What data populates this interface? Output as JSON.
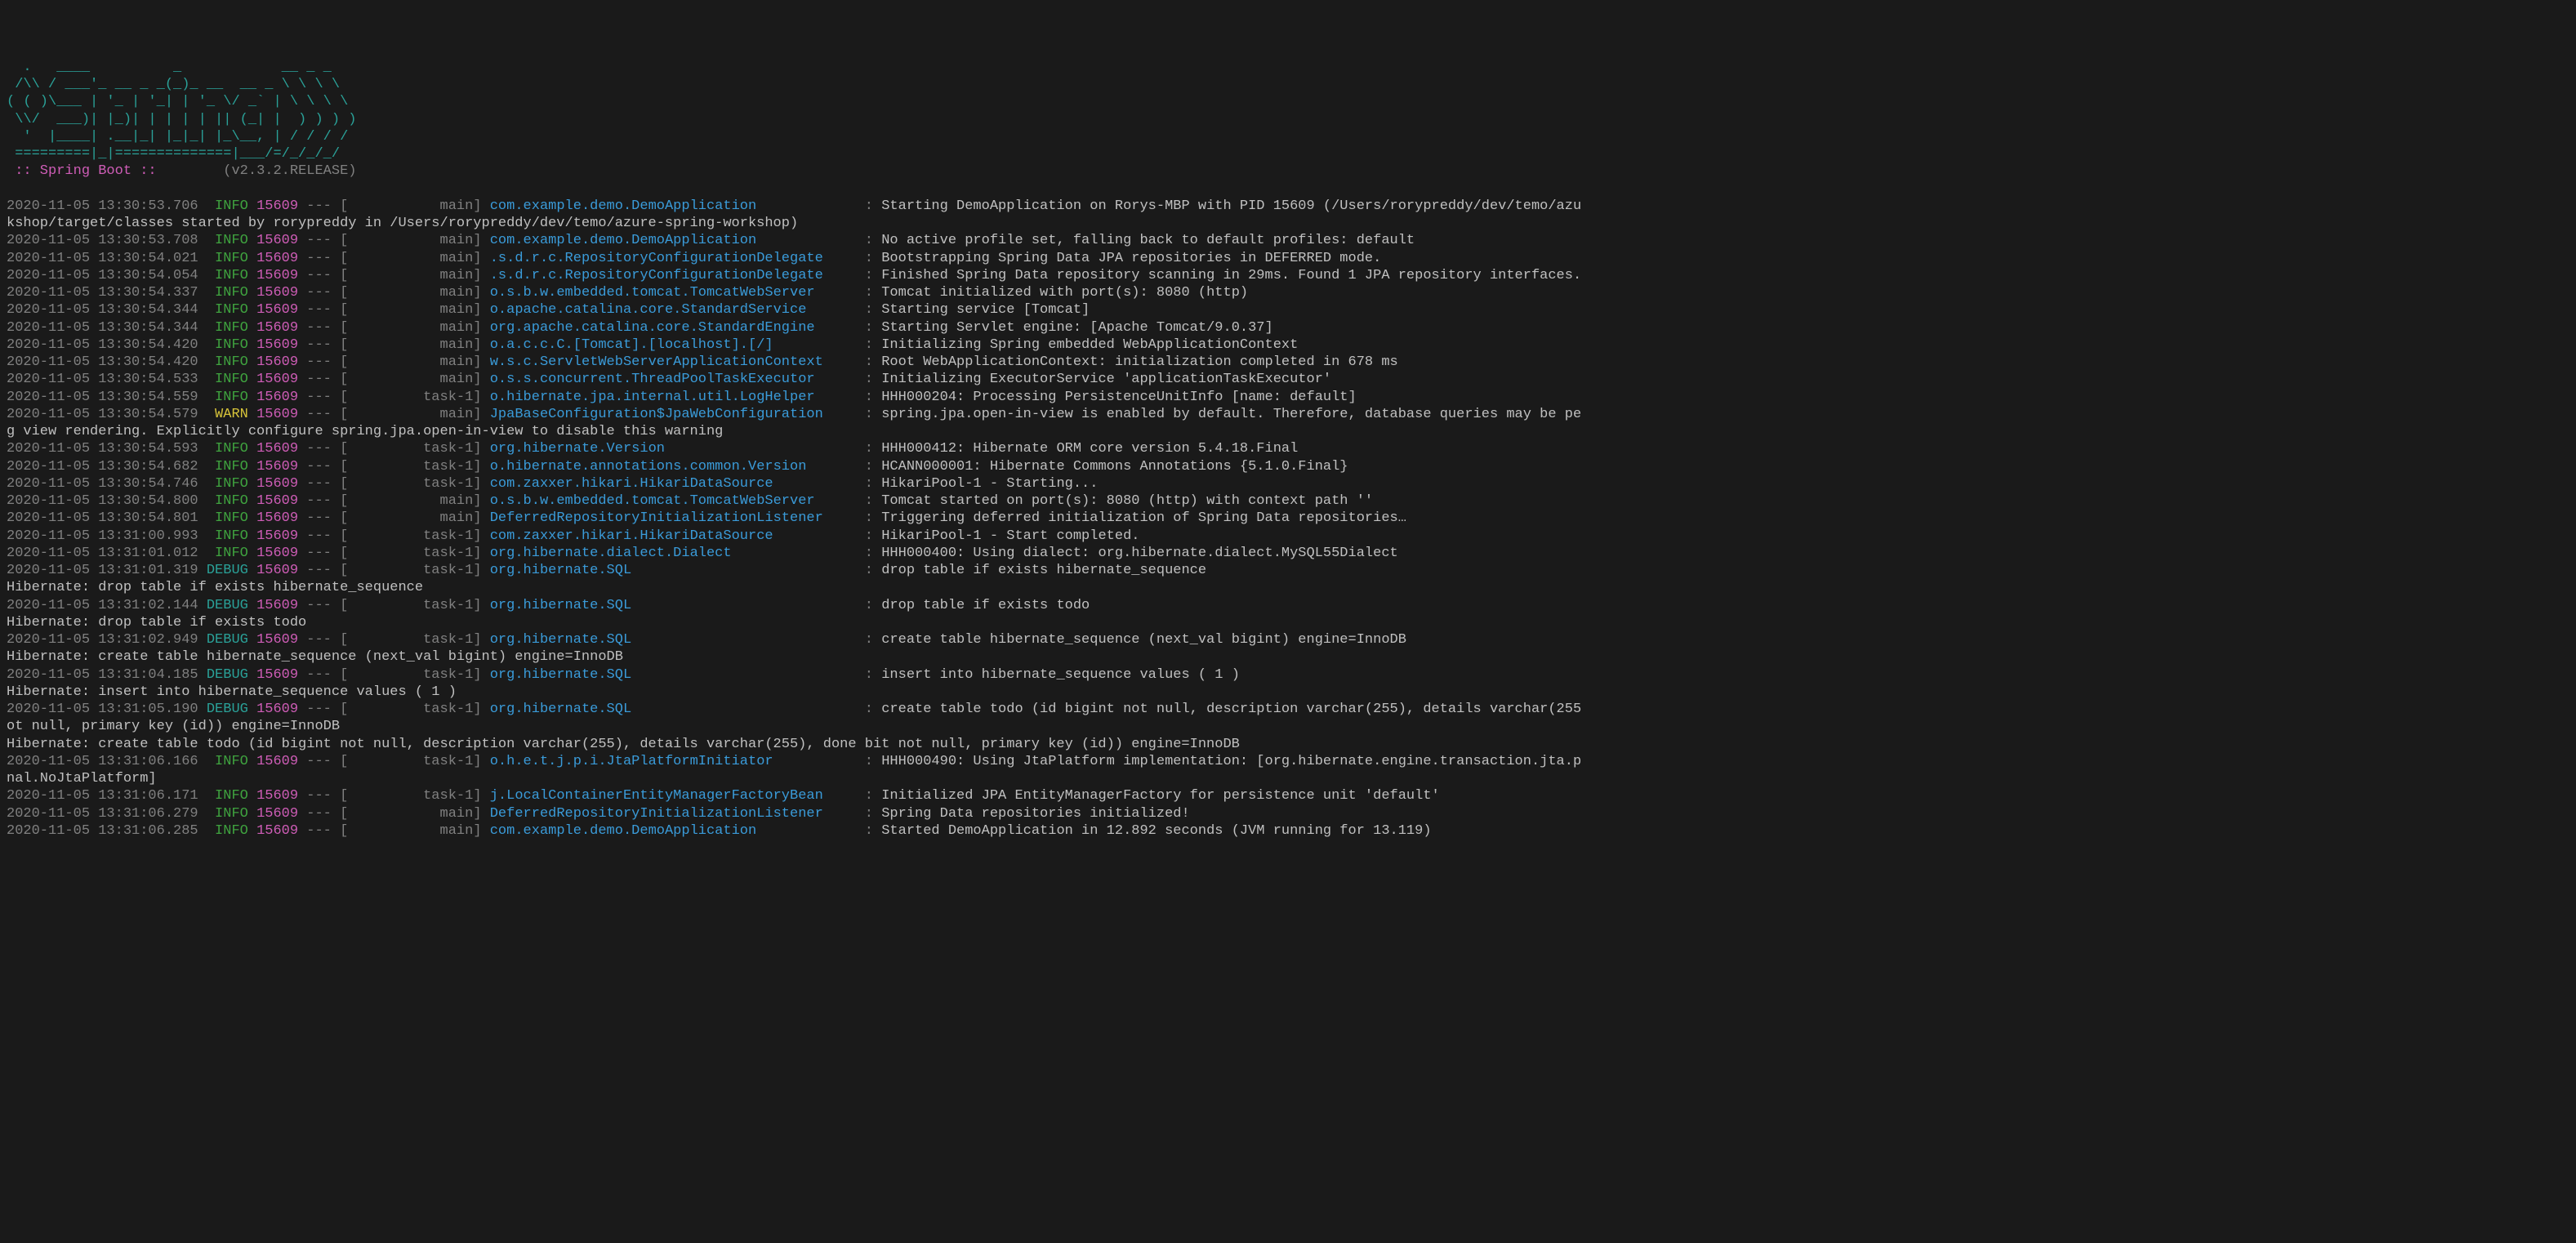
{
  "banner": [
    "  .   ____          _            __ _ _",
    " /\\\\ / ___'_ __ _ _(_)_ __  __ _ \\ \\ \\ \\",
    "( ( )\\___ | '_ | '_| | '_ \\/ _` | \\ \\ \\ \\",
    " \\\\/  ___)| |_)| | | | | || (_| |  ) ) ) )",
    "  '  |____| .__|_| |_|_| |_\\__, | / / / /",
    " =========|_|==============|___/=/_/_/_/"
  ],
  "banner_footer": {
    "label": " :: Spring Boot ::",
    "spacing": "        ",
    "version": "(v2.3.2.RELEASE)"
  },
  "lines": [
    {
      "type": "log",
      "ts": "2020-11-05 13:30:53.706",
      "level": "INFO",
      "pid": "15609",
      "thread": "main",
      "logger": "com.example.demo.DemoApplication",
      "msg": "Starting DemoApplication on Rorys-MBP with PID 15609 (/Users/rorypreddy/dev/temo/azu"
    },
    {
      "type": "cont",
      "text": "kshop/target/classes started by rorypreddy in /Users/rorypreddy/dev/temo/azure-spring-workshop)"
    },
    {
      "type": "log",
      "ts": "2020-11-05 13:30:53.708",
      "level": "INFO",
      "pid": "15609",
      "thread": "main",
      "logger": "com.example.demo.DemoApplication",
      "msg": "No active profile set, falling back to default profiles: default"
    },
    {
      "type": "log",
      "ts": "2020-11-05 13:30:54.021",
      "level": "INFO",
      "pid": "15609",
      "thread": "main",
      "logger": ".s.d.r.c.RepositoryConfigurationDelegate",
      "msg": "Bootstrapping Spring Data JPA repositories in DEFERRED mode."
    },
    {
      "type": "log",
      "ts": "2020-11-05 13:30:54.054",
      "level": "INFO",
      "pid": "15609",
      "thread": "main",
      "logger": ".s.d.r.c.RepositoryConfigurationDelegate",
      "msg": "Finished Spring Data repository scanning in 29ms. Found 1 JPA repository interfaces."
    },
    {
      "type": "log",
      "ts": "2020-11-05 13:30:54.337",
      "level": "INFO",
      "pid": "15609",
      "thread": "main",
      "logger": "o.s.b.w.embedded.tomcat.TomcatWebServer",
      "msg": "Tomcat initialized with port(s): 8080 (http)"
    },
    {
      "type": "log",
      "ts": "2020-11-05 13:30:54.344",
      "level": "INFO",
      "pid": "15609",
      "thread": "main",
      "logger": "o.apache.catalina.core.StandardService",
      "msg": "Starting service [Tomcat]"
    },
    {
      "type": "log",
      "ts": "2020-11-05 13:30:54.344",
      "level": "INFO",
      "pid": "15609",
      "thread": "main",
      "logger": "org.apache.catalina.core.StandardEngine",
      "msg": "Starting Servlet engine: [Apache Tomcat/9.0.37]"
    },
    {
      "type": "log",
      "ts": "2020-11-05 13:30:54.420",
      "level": "INFO",
      "pid": "15609",
      "thread": "main",
      "logger": "o.a.c.c.C.[Tomcat].[localhost].[/]",
      "msg": "Initializing Spring embedded WebApplicationContext"
    },
    {
      "type": "log",
      "ts": "2020-11-05 13:30:54.420",
      "level": "INFO",
      "pid": "15609",
      "thread": "main",
      "logger": "w.s.c.ServletWebServerApplicationContext",
      "msg": "Root WebApplicationContext: initialization completed in 678 ms"
    },
    {
      "type": "log",
      "ts": "2020-11-05 13:30:54.533",
      "level": "INFO",
      "pid": "15609",
      "thread": "main",
      "logger": "o.s.s.concurrent.ThreadPoolTaskExecutor",
      "msg": "Initializing ExecutorService 'applicationTaskExecutor'"
    },
    {
      "type": "log",
      "ts": "2020-11-05 13:30:54.559",
      "level": "INFO",
      "pid": "15609",
      "thread": "task-1",
      "logger": "o.hibernate.jpa.internal.util.LogHelper",
      "msg": "HHH000204: Processing PersistenceUnitInfo [name: default]"
    },
    {
      "type": "log",
      "ts": "2020-11-05 13:30:54.579",
      "level": "WARN",
      "pid": "15609",
      "thread": "main",
      "logger": "JpaBaseConfiguration$JpaWebConfiguration",
      "msg": "spring.jpa.open-in-view is enabled by default. Therefore, database queries may be pe"
    },
    {
      "type": "cont",
      "text": "g view rendering. Explicitly configure spring.jpa.open-in-view to disable this warning"
    },
    {
      "type": "log",
      "ts": "2020-11-05 13:30:54.593",
      "level": "INFO",
      "pid": "15609",
      "thread": "task-1",
      "logger": "org.hibernate.Version",
      "msg": "HHH000412: Hibernate ORM core version 5.4.18.Final"
    },
    {
      "type": "log",
      "ts": "2020-11-05 13:30:54.682",
      "level": "INFO",
      "pid": "15609",
      "thread": "task-1",
      "logger": "o.hibernate.annotations.common.Version",
      "msg": "HCANN000001: Hibernate Commons Annotations {5.1.0.Final}"
    },
    {
      "type": "log",
      "ts": "2020-11-05 13:30:54.746",
      "level": "INFO",
      "pid": "15609",
      "thread": "task-1",
      "logger": "com.zaxxer.hikari.HikariDataSource",
      "msg": "HikariPool-1 - Starting..."
    },
    {
      "type": "log",
      "ts": "2020-11-05 13:30:54.800",
      "level": "INFO",
      "pid": "15609",
      "thread": "main",
      "logger": "o.s.b.w.embedded.tomcat.TomcatWebServer",
      "msg": "Tomcat started on port(s): 8080 (http) with context path ''"
    },
    {
      "type": "log",
      "ts": "2020-11-05 13:30:54.801",
      "level": "INFO",
      "pid": "15609",
      "thread": "main",
      "logger": "DeferredRepositoryInitializationListener",
      "msg": "Triggering deferred initialization of Spring Data repositories…"
    },
    {
      "type": "log",
      "ts": "2020-11-05 13:31:00.993",
      "level": "INFO",
      "pid": "15609",
      "thread": "task-1",
      "logger": "com.zaxxer.hikari.HikariDataSource",
      "msg": "HikariPool-1 - Start completed."
    },
    {
      "type": "log",
      "ts": "2020-11-05 13:31:01.012",
      "level": "INFO",
      "pid": "15609",
      "thread": "task-1",
      "logger": "org.hibernate.dialect.Dialect",
      "msg": "HHH000400: Using dialect: org.hibernate.dialect.MySQL55Dialect"
    },
    {
      "type": "log",
      "ts": "2020-11-05 13:31:01.319",
      "level": "DEBUG",
      "pid": "15609",
      "thread": "task-1",
      "logger": "org.hibernate.SQL",
      "msg": "drop table if exists hibernate_sequence"
    },
    {
      "type": "cont",
      "text": "Hibernate: drop table if exists hibernate_sequence"
    },
    {
      "type": "log",
      "ts": "2020-11-05 13:31:02.144",
      "level": "DEBUG",
      "pid": "15609",
      "thread": "task-1",
      "logger": "org.hibernate.SQL",
      "msg": "drop table if exists todo"
    },
    {
      "type": "cont",
      "text": "Hibernate: drop table if exists todo"
    },
    {
      "type": "log",
      "ts": "2020-11-05 13:31:02.949",
      "level": "DEBUG",
      "pid": "15609",
      "thread": "task-1",
      "logger": "org.hibernate.SQL",
      "msg": "create table hibernate_sequence (next_val bigint) engine=InnoDB"
    },
    {
      "type": "cont",
      "text": "Hibernate: create table hibernate_sequence (next_val bigint) engine=InnoDB"
    },
    {
      "type": "log",
      "ts": "2020-11-05 13:31:04.185",
      "level": "DEBUG",
      "pid": "15609",
      "thread": "task-1",
      "logger": "org.hibernate.SQL",
      "msg": "insert into hibernate_sequence values ( 1 )"
    },
    {
      "type": "cont",
      "text": "Hibernate: insert into hibernate_sequence values ( 1 )"
    },
    {
      "type": "log",
      "ts": "2020-11-05 13:31:05.190",
      "level": "DEBUG",
      "pid": "15609",
      "thread": "task-1",
      "logger": "org.hibernate.SQL",
      "msg": "create table todo (id bigint not null, description varchar(255), details varchar(255"
    },
    {
      "type": "cont",
      "text": "ot null, primary key (id)) engine=InnoDB"
    },
    {
      "type": "cont",
      "text": "Hibernate: create table todo (id bigint not null, description varchar(255), details varchar(255), done bit not null, primary key (id)) engine=InnoDB"
    },
    {
      "type": "log",
      "ts": "2020-11-05 13:31:06.166",
      "level": "INFO",
      "pid": "15609",
      "thread": "task-1",
      "logger": "o.h.e.t.j.p.i.JtaPlatformInitiator",
      "msg": "HHH000490: Using JtaPlatform implementation: [org.hibernate.engine.transaction.jta.p"
    },
    {
      "type": "cont",
      "text": "nal.NoJtaPlatform]"
    },
    {
      "type": "log",
      "ts": "2020-11-05 13:31:06.171",
      "level": "INFO",
      "pid": "15609",
      "thread": "task-1",
      "logger": "j.LocalContainerEntityManagerFactoryBean",
      "msg": "Initialized JPA EntityManagerFactory for persistence unit 'default'"
    },
    {
      "type": "log",
      "ts": "2020-11-05 13:31:06.279",
      "level": "INFO",
      "pid": "15609",
      "thread": "main",
      "logger": "DeferredRepositoryInitializationListener",
      "msg": "Spring Data repositories initialized!"
    },
    {
      "type": "log",
      "ts": "2020-11-05 13:31:06.285",
      "level": "INFO",
      "pid": "15609",
      "thread": "main",
      "logger": "com.example.demo.DemoApplication",
      "msg": "Started DemoApplication in 12.892 seconds (JVM running for 13.119)"
    }
  ],
  "widths": {
    "level": 5,
    "thread": 15,
    "logger": 44
  }
}
